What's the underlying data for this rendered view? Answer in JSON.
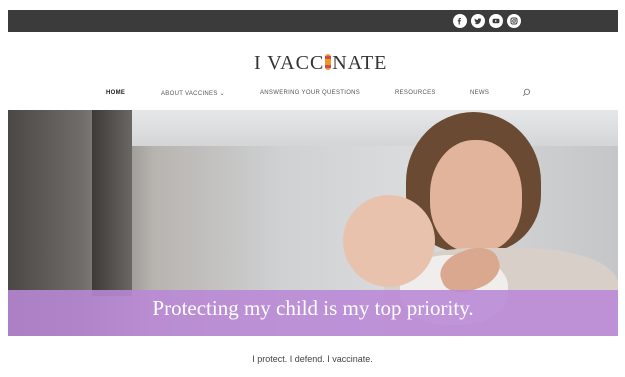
{
  "social": {
    "icons": [
      "facebook-icon",
      "twitter-icon",
      "youtube-icon",
      "instagram-icon"
    ]
  },
  "logo": {
    "text_before": "I VACC",
    "text_after": "NATE"
  },
  "nav": {
    "items": [
      {
        "label": "HOME",
        "active": true
      },
      {
        "label": "ABOUT VACCINES ⌄",
        "active": false
      },
      {
        "label": "ANSWERING YOUR QUESTIONS",
        "active": false
      },
      {
        "label": "RESOURCES",
        "active": false
      },
      {
        "label": "NEWS",
        "active": false
      }
    ]
  },
  "hero": {
    "headline": "Protecting my child is my top priority.",
    "overlay_color": "#ba88d6"
  },
  "tagline": "I protect. I defend. I vaccinate.",
  "colors": {
    "topbar": "#3b3b3b",
    "logo_accent": "#e89a2a"
  }
}
